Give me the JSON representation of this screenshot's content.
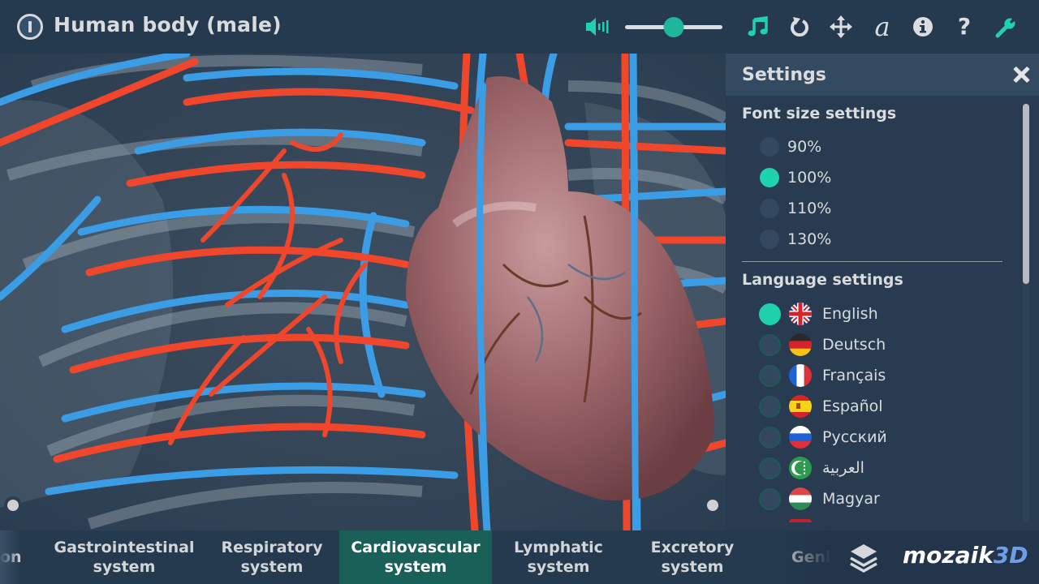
{
  "app": {
    "title": "Human body (male)"
  },
  "toolbar": {
    "icons": [
      "power-icon",
      "volume-icon",
      "music-icon",
      "reset-icon",
      "move-icon",
      "font-icon",
      "info-icon",
      "help-icon",
      "wrench-icon"
    ],
    "volume_level_percent": 50,
    "accent_color": "#1fd1ad"
  },
  "settings": {
    "title": "Settings",
    "font_size": {
      "heading": "Font size settings",
      "options": [
        {
          "label": "90%",
          "selected": false
        },
        {
          "label": "100%",
          "selected": true
        },
        {
          "label": "110%",
          "selected": false
        },
        {
          "label": "130%",
          "selected": false
        }
      ]
    },
    "language": {
      "heading": "Language settings",
      "options": [
        {
          "label": "English",
          "flag": "uk-flag",
          "selected": true
        },
        {
          "label": "Deutsch",
          "flag": "germany-flag",
          "selected": false
        },
        {
          "label": "Français",
          "flag": "france-flag",
          "selected": false
        },
        {
          "label": "Español",
          "flag": "spain-flag",
          "selected": false
        },
        {
          "label": "Русский",
          "flag": "russia-flag",
          "selected": false
        },
        {
          "label": "العربية",
          "flag": "comoros-flag",
          "selected": false
        },
        {
          "label": "Magyar",
          "flag": "hungary-flag",
          "selected": false
        }
      ]
    }
  },
  "bottom_tabs": [
    {
      "line1": "on",
      "line2": "",
      "active": false
    },
    {
      "line1": "Gastrointestinal",
      "line2": "system",
      "active": false
    },
    {
      "line1": "Respiratory",
      "line2": "system",
      "active": false
    },
    {
      "line1": "Cardiovascular",
      "line2": "system",
      "active": true
    },
    {
      "line1": "Lymphatic",
      "line2": "system",
      "active": false
    },
    {
      "line1": "Excretory",
      "line2": "system",
      "active": false
    },
    {
      "line1": "Genit",
      "line2": "",
      "active": false
    }
  ],
  "brand": {
    "name": "mozaik",
    "suffix": "3D"
  }
}
